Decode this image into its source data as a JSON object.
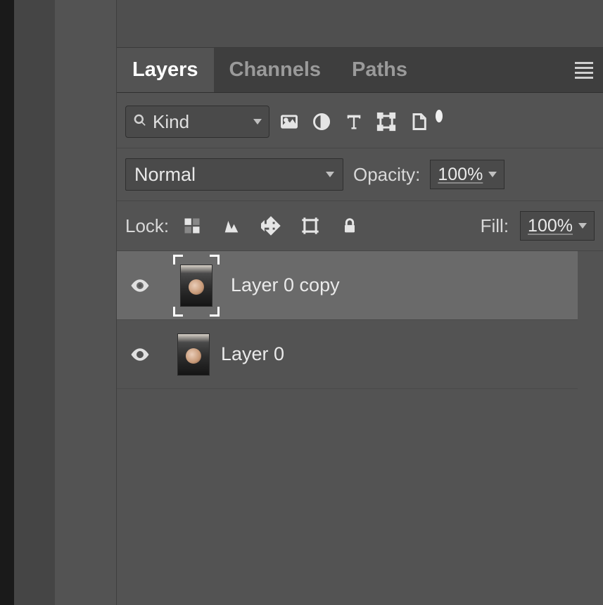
{
  "tabs": {
    "layers": "Layers",
    "channels": "Channels",
    "paths": "Paths"
  },
  "filter": {
    "kind_selected": "Kind"
  },
  "blend": {
    "mode": "Normal",
    "opacity_label": "Opacity:",
    "opacity_value": "100%"
  },
  "lock": {
    "label": "Lock:",
    "fill_label": "Fill:",
    "fill_value": "100%"
  },
  "layers": [
    {
      "name": "Layer 0 copy",
      "visible": true,
      "selected": true
    },
    {
      "name": "Layer 0",
      "visible": true,
      "selected": false
    }
  ]
}
